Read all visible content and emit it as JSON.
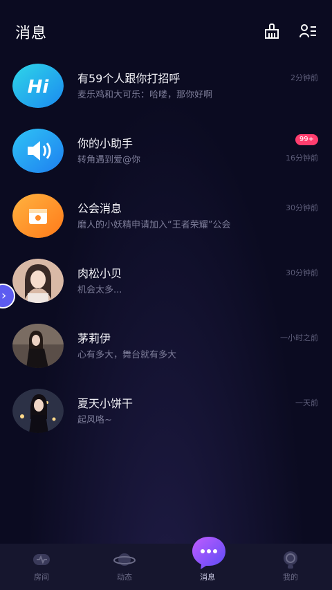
{
  "header": {
    "title": "消息",
    "icons": [
      "broom-icon",
      "contacts-icon"
    ]
  },
  "conversations": [
    {
      "name": "有59个人跟你打招呼",
      "preview": "麦乐鸡和大可乐：哈喽，那你好啊",
      "time": "2分钟前",
      "avatar": "hi-icon"
    },
    {
      "name": "你的小助手",
      "preview": "转角遇到爱@你",
      "time": "16分钟前",
      "badge": "99+",
      "avatar": "speaker-icon"
    },
    {
      "name": "公会消息",
      "preview": "磨人的小妖精申请加入“王者荣耀”公会",
      "time": "30分钟前",
      "avatar": "guild-icon"
    },
    {
      "name": "肉松小贝",
      "preview": "机会太多...",
      "time": "30分钟前",
      "avatar": "user-photo"
    },
    {
      "name": "茅莉伊",
      "preview": "心有多大，舞台就有多大",
      "time": "一小时之前",
      "avatar": "user-photo"
    },
    {
      "name": "夏天小饼干",
      "preview": "起风咯~",
      "time": "一天前",
      "avatar": "user-photo"
    }
  ],
  "tabbar": {
    "tabs": [
      {
        "label": "房间",
        "icon": "room-icon"
      },
      {
        "label": "动态",
        "icon": "planet-icon"
      },
      {
        "label": "消息",
        "icon": "chat-bubble-icon",
        "active": true
      },
      {
        "label": "我的",
        "icon": "profile-icon"
      }
    ]
  },
  "colors": {
    "background": "#0b0b21",
    "badge": "#ff3d6e",
    "accent": "#5d5cf0"
  }
}
